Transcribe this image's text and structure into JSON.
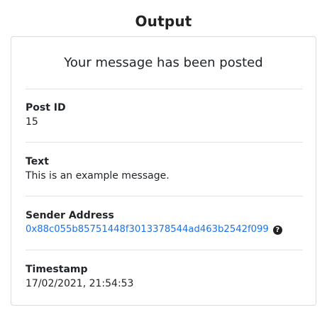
{
  "page": {
    "title": "Output"
  },
  "card": {
    "heading": "Your message has been posted",
    "fields": {
      "post_id": {
        "label": "Post ID",
        "value": "15"
      },
      "text": {
        "label": "Text",
        "value": "This is an example message."
      },
      "sender_address": {
        "label": "Sender Address",
        "value": "0x88c055b85751448f3013378544ad463b2542f099",
        "help_icon": "?"
      },
      "timestamp": {
        "label": "Timestamp",
        "value": "17/02/2021, 21:54:53"
      }
    }
  },
  "colors": {
    "link": "#1a73e8",
    "border": "#dcdcdc",
    "divider": "#e2e2e2"
  },
  "icons": {
    "help": "question-circle-icon"
  }
}
